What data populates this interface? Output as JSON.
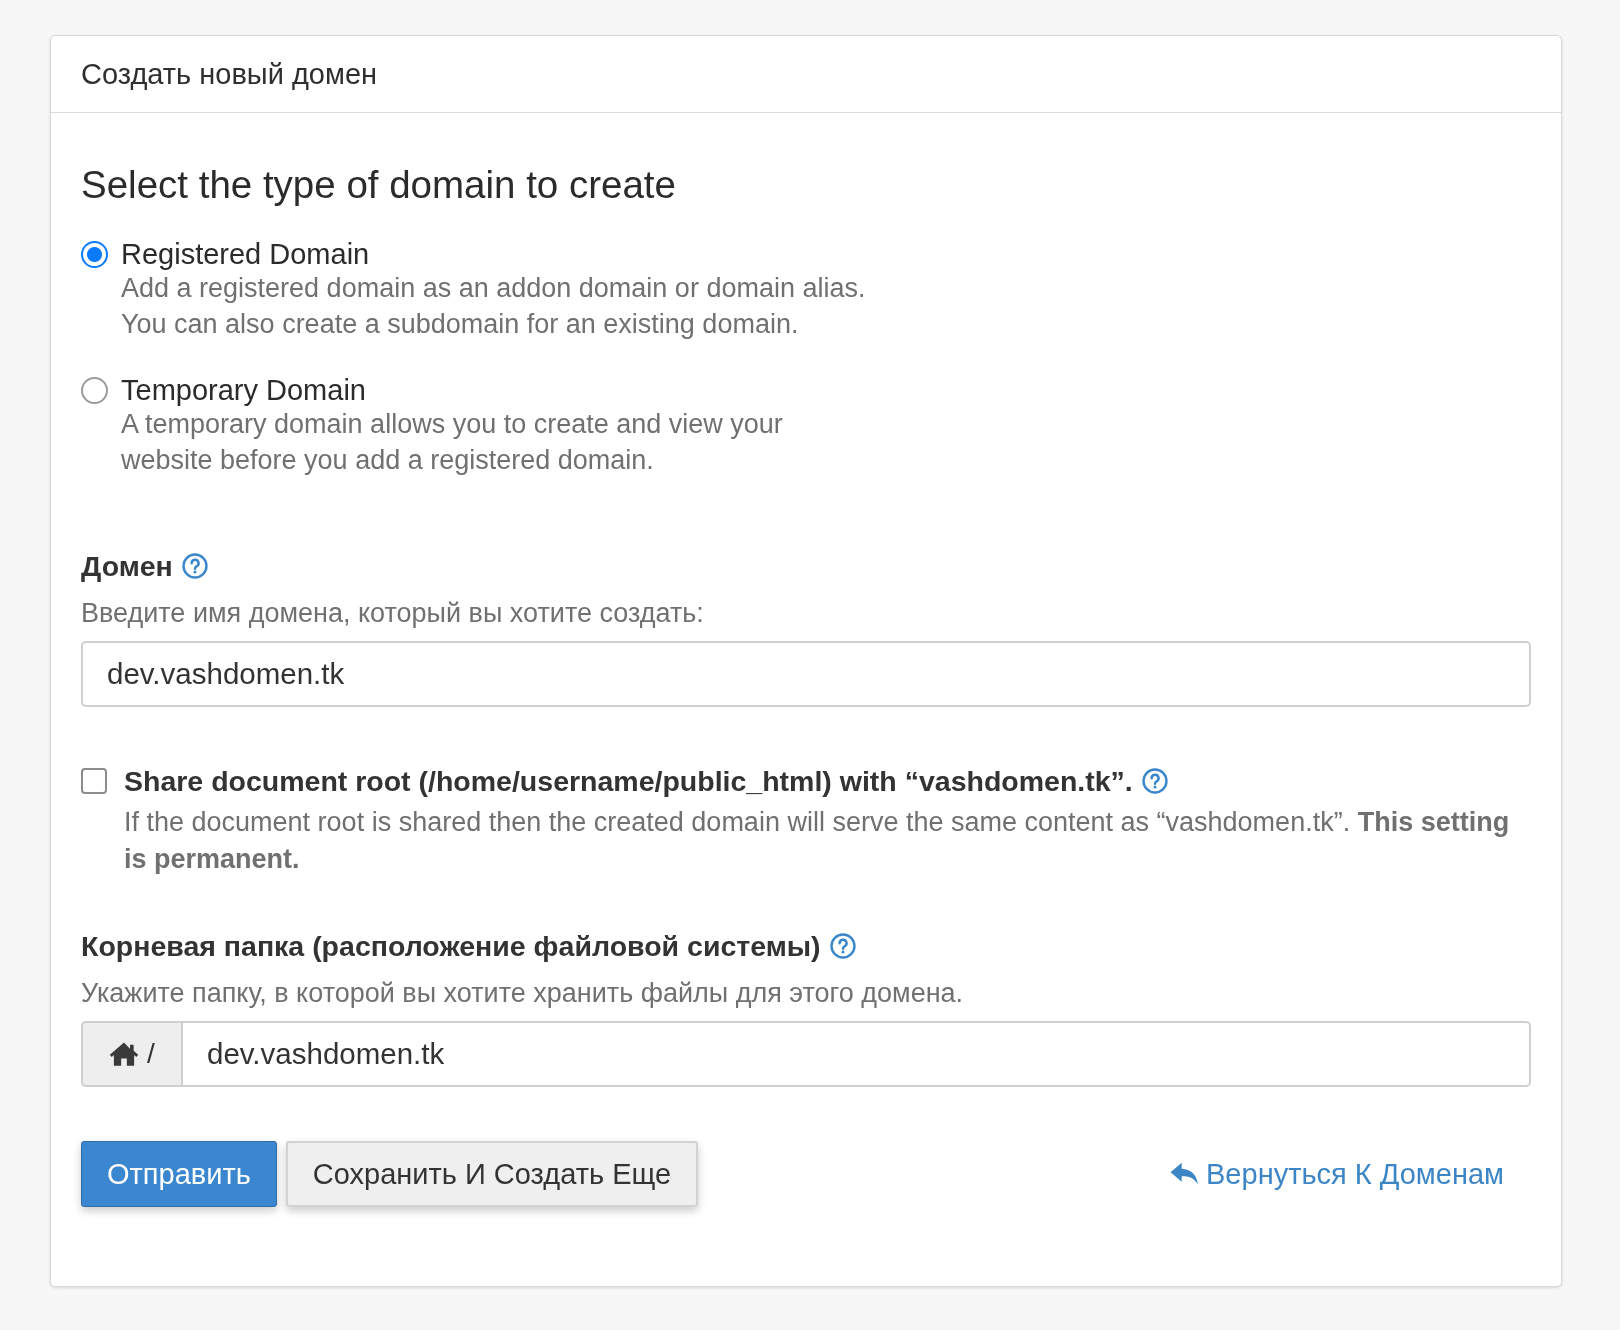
{
  "panel": {
    "title": "Создать новый домен"
  },
  "domain_type": {
    "heading": "Select the type of domain to create",
    "options": [
      {
        "label": "Registered Domain",
        "description": "Add a registered domain as an addon domain or domain alias. You can also create a subdomain for an existing domain.",
        "selected": true
      },
      {
        "label": "Temporary Domain",
        "description": "A temporary domain allows you to create and view your website before you add a registered domain.",
        "selected": false
      }
    ]
  },
  "domain_field": {
    "label": "Домен",
    "hint": "Введите имя домена, который вы хотите создать:",
    "value": "dev.vashdomen.tk"
  },
  "share_root": {
    "label": "Share document root (/home/username/public_html) with “vashdomen.tk”.",
    "description": "If the document root is shared then the created domain will serve the same content as “vashdomen.tk”. **This setting is permanent.**",
    "checked": false
  },
  "root_field": {
    "label": "Корневая папка (расположение файловой системы)",
    "hint": "Укажите папку, в которой вы хотите хранить файлы для этого домена.",
    "prefix": "/",
    "value": "dev.vashdomen.tk"
  },
  "buttons": [
    {
      "label": "Отправить",
      "kind": "primary"
    },
    {
      "label": "Сохранить И Создать Еще",
      "kind": "secondary"
    }
  ],
  "back_link": {
    "label": "Вернуться К Доменам"
  }
}
